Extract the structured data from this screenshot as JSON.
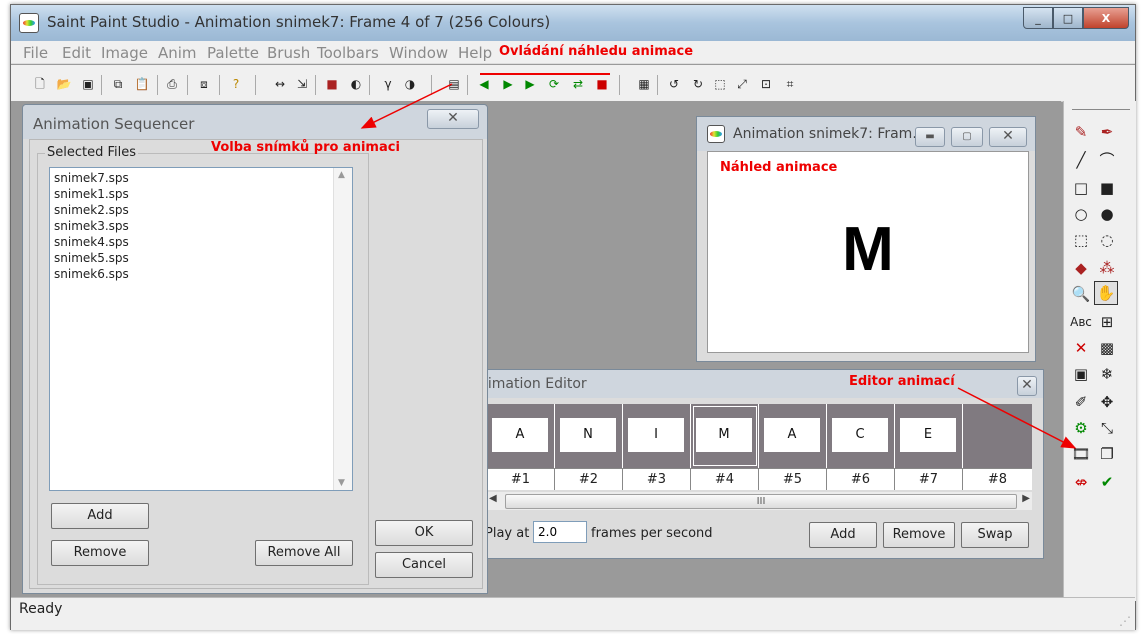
{
  "app": {
    "title": "Saint Paint Studio - Animation snimek7: Frame 4 of 7 (256 Colours)",
    "window_buttons": [
      "_",
      "□",
      "X"
    ]
  },
  "menu": [
    "File",
    "Edit",
    "Image",
    "Anim",
    "Palette",
    "Brush",
    "Toolbars",
    "Window",
    "Help"
  ],
  "toolbar_icons": [
    "new-file",
    "open-folder",
    "save",
    "copy",
    "paste",
    "print",
    "copy-to",
    "help",
    "flip-horizontal",
    "resize",
    "color-palette",
    "contrast",
    "gamma",
    "invert",
    "animation-sequencer",
    "play-reverse",
    "play-forward",
    "step-forward",
    "loop",
    "bounce",
    "stop",
    "grid-view",
    "rotate-left",
    "rotate-right",
    "crop-select",
    "zoom-fit",
    "zoom-region",
    "transform"
  ],
  "annotations": {
    "toolbar_note": "Ovládání náhledu animace",
    "sequencer_note": "Volba snímků pro animaci",
    "preview_note": "Náhled animace",
    "editor_note": "Editor animací"
  },
  "sequencer": {
    "title": "Animation Sequencer",
    "group_label": "Selected Files",
    "files": [
      "snimek7.sps",
      "snimek1.sps",
      "snimek2.sps",
      "snimek3.sps",
      "snimek4.sps",
      "snimek5.sps",
      "snimek6.sps"
    ],
    "add_label": "Add",
    "remove_label": "Remove",
    "remove_all_label": "Remove All",
    "ok_label": "OK",
    "cancel_label": "Cancel"
  },
  "preview": {
    "title": "Animation snimek7: Fram...",
    "letter": "M"
  },
  "editor": {
    "title": "nimation Editor",
    "frames": [
      {
        "letter": "A",
        "label": "#1"
      },
      {
        "letter": "N",
        "label": "#2"
      },
      {
        "letter": "I",
        "label": "#3"
      },
      {
        "letter": "M",
        "label": "#4",
        "selected": true
      },
      {
        "letter": "A",
        "label": "#5"
      },
      {
        "letter": "C",
        "label": "#6"
      },
      {
        "letter": "E",
        "label": "#7"
      },
      {
        "letter": "",
        "label": "#8"
      }
    ],
    "scroll_label": "III",
    "play_at_label": "Play at",
    "fps_value": "2.0",
    "fps_unit_label": "frames per second",
    "add_label": "Add",
    "remove_label": "Remove",
    "swap_label": "Swap"
  },
  "status": "Ready",
  "colors": {
    "annotation": "#e00000",
    "workspace": "#9a9a9a",
    "frame_strip": "#807a80"
  }
}
